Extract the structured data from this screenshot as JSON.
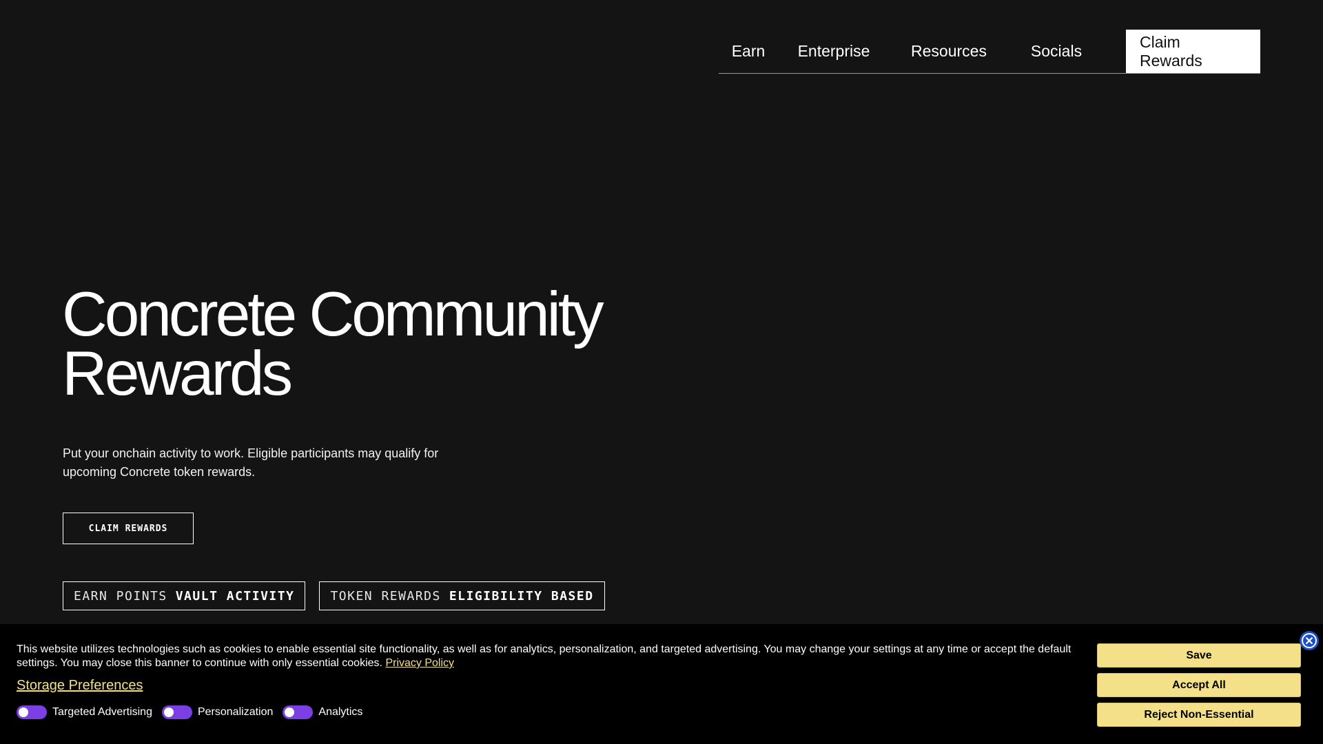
{
  "nav": {
    "items": [
      {
        "label": "Earn"
      },
      {
        "label": "Enterprise"
      },
      {
        "label": "Resources"
      },
      {
        "label": "Socials"
      }
    ],
    "cta_label": "Claim Rewards"
  },
  "hero": {
    "title_line1": "Concrete Community",
    "title_line2": "Rewards",
    "subtitle": "Put your onchain activity to work. Eligible participants may qualify for upcoming Concrete token rewards.",
    "cta_label": "CLAIM REWARDS",
    "tags": [
      {
        "label": "EARN POINTS",
        "value": "VAULT ACTIVITY"
      },
      {
        "label": "TOKEN REWARDS",
        "value": "ELIGIBILITY BASED"
      }
    ]
  },
  "cookie_banner": {
    "text": "This website utilizes technologies such as cookies to enable essential site functionality, as well as for analytics, personalization, and targeted advertising. You may change your settings at any time or accept the default settings. You may close this banner to continue with only essential cookies.",
    "privacy_link": "Privacy Policy",
    "storage_preferences_label": "Storage Preferences",
    "toggles": [
      {
        "label": "Targeted Advertising"
      },
      {
        "label": "Personalization"
      },
      {
        "label": "Analytics"
      }
    ],
    "buttons": {
      "save": "Save",
      "accept_all": "Accept All",
      "reject": "Reject Non-Essential"
    },
    "close_icon": "close-icon"
  },
  "colors": {
    "background": "#141414",
    "banner_background": "#000000",
    "banner_button": "#f5e08a",
    "toggle": "#7b3fe4",
    "close_button": "#1b4fc9"
  }
}
